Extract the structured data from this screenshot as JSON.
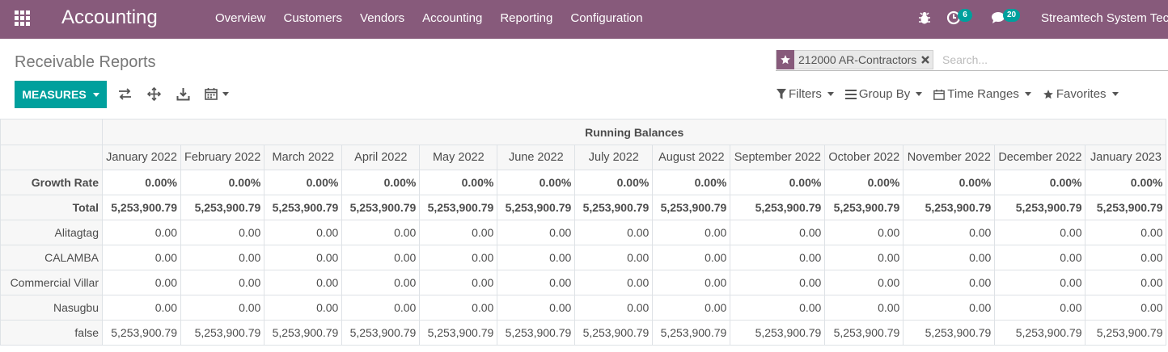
{
  "navbar": {
    "brand": "Accounting",
    "menu": [
      "Overview",
      "Customers",
      "Vendors",
      "Accounting",
      "Reporting",
      "Configuration"
    ],
    "activity_count": "6",
    "message_count": "20",
    "company": "Streamtech System Tech",
    "accent_color": "#875a7b"
  },
  "control": {
    "title": "Receivable Reports",
    "facet_label": "212000 AR-Contractors",
    "search_placeholder": "Search...",
    "measures_label": "MEASURES",
    "filters": [
      "Filters",
      "Group By",
      "Time Ranges",
      "Favorites"
    ],
    "button_color": "#00a09d"
  },
  "table": {
    "group_header": "Running Balances",
    "columns": [
      "January 2022",
      "February 2022",
      "March 2022",
      "April 2022",
      "May 2022",
      "June 2022",
      "July 2022",
      "August 2022",
      "September 2022",
      "October 2022",
      "November 2022",
      "December 2022",
      "January 2023"
    ],
    "rows": [
      {
        "label": "Growth Rate",
        "bold": true,
        "values": [
          "0.00%",
          "0.00%",
          "0.00%",
          "0.00%",
          "0.00%",
          "0.00%",
          "0.00%",
          "0.00%",
          "0.00%",
          "0.00%",
          "0.00%",
          "0.00%",
          "0.00%"
        ]
      },
      {
        "label": "Total",
        "bold": true,
        "values": [
          "5,253,900.79",
          "5,253,900.79",
          "5,253,900.79",
          "5,253,900.79",
          "5,253,900.79",
          "5,253,900.79",
          "5,253,900.79",
          "5,253,900.79",
          "5,253,900.79",
          "5,253,900.79",
          "5,253,900.79",
          "5,253,900.79",
          "5,253,900.79"
        ]
      },
      {
        "label": "Alitagtag",
        "bold": false,
        "values": [
          "0.00",
          "0.00",
          "0.00",
          "0.00",
          "0.00",
          "0.00",
          "0.00",
          "0.00",
          "0.00",
          "0.00",
          "0.00",
          "0.00",
          "0.00"
        ]
      },
      {
        "label": "CALAMBA",
        "bold": false,
        "values": [
          "0.00",
          "0.00",
          "0.00",
          "0.00",
          "0.00",
          "0.00",
          "0.00",
          "0.00",
          "0.00",
          "0.00",
          "0.00",
          "0.00",
          "0.00"
        ]
      },
      {
        "label": "Commercial Villar",
        "bold": false,
        "values": [
          "0.00",
          "0.00",
          "0.00",
          "0.00",
          "0.00",
          "0.00",
          "0.00",
          "0.00",
          "0.00",
          "0.00",
          "0.00",
          "0.00",
          "0.00"
        ]
      },
      {
        "label": "Nasugbu",
        "bold": false,
        "values": [
          "0.00",
          "0.00",
          "0.00",
          "0.00",
          "0.00",
          "0.00",
          "0.00",
          "0.00",
          "0.00",
          "0.00",
          "0.00",
          "0.00",
          "0.00"
        ]
      },
      {
        "label": "false",
        "bold": false,
        "values": [
          "5,253,900.79",
          "5,253,900.79",
          "5,253,900.79",
          "5,253,900.79",
          "5,253,900.79",
          "5,253,900.79",
          "5,253,900.79",
          "5,253,900.79",
          "5,253,900.79",
          "5,253,900.79",
          "5,253,900.79",
          "5,253,900.79",
          "5,253,900.79"
        ]
      }
    ]
  }
}
